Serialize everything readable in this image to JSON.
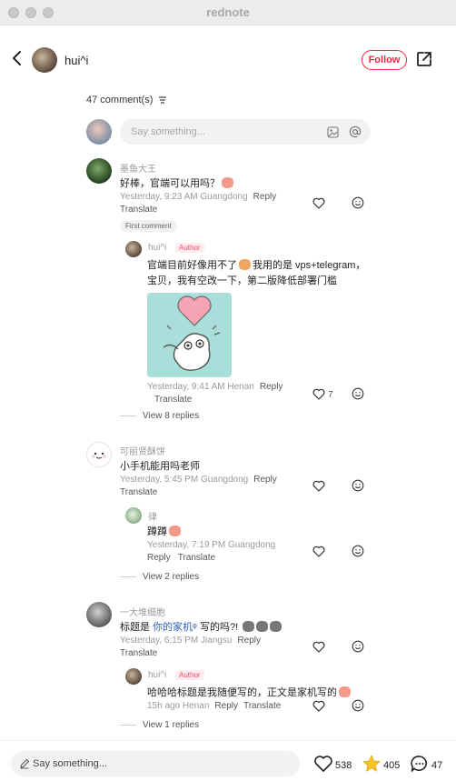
{
  "window": {
    "title": "rednote"
  },
  "header": {
    "username": "hui^i",
    "follow_label": "Follow"
  },
  "comments_meta": {
    "count_label": "47 comment(s)"
  },
  "comment_input": {
    "placeholder": "Say something..."
  },
  "comments": [
    {
      "name": "墨鱼大王",
      "text": "好棒，官端可以用吗？",
      "meta": "Yesterday, 9:23 AM Guangdong",
      "reply": "Reply",
      "translate": "Translate",
      "tag": "First comment",
      "replies": [
        {
          "name": "hui^i",
          "badge": "Author",
          "text_line1": "官端目前好像用不了",
          "text_line1b": "我用的是 vps+telegram，",
          "text_line2": "宝贝，我有空改一下，第二版降低部署门槛",
          "meta": "Yesterday, 9:41 AM Henan",
          "reply": "Reply",
          "translate": "Translate",
          "likes": "7"
        }
      ],
      "view_replies": "View 8 replies"
    },
    {
      "name": "可丽贤酥饼",
      "text": "小手机能用吗老师",
      "meta": "Yesterday, 5:45 PM Guangdong",
      "reply": "Reply",
      "translate": "Translate",
      "replies": [
        {
          "name": "律",
          "text": "蹲蹲",
          "meta": "Yesterday, 7:19 PM Guangdong",
          "reply": "Reply",
          "translate": "Translate"
        }
      ],
      "view_replies": "View 2 replies"
    },
    {
      "name": "一大堆细胞",
      "text_pre": "标题是 ",
      "text_link": "你的家机ᵠ",
      "text_post": " 写的吗?!",
      "meta": "Yesterday, 6:15 PM Jiangsu",
      "reply": "Reply",
      "translate": "Translate",
      "replies": [
        {
          "name": "hui^i",
          "badge": "Author",
          "text": "哈哈哈标题是我随便写的，正文是家机写的",
          "meta": "15h ago Henan",
          "reply": "Reply",
          "translate": "Translate"
        }
      ],
      "view_replies": "View 1 replies"
    }
  ],
  "bottom_bar": {
    "placeholder": "Say something...",
    "likes": "538",
    "stars": "405",
    "comments": "47"
  },
  "colors": {
    "brand_red": "#ff2442",
    "star_yellow": "#f6c32b"
  },
  "icons": [
    "back-arrow-icon",
    "share-icon",
    "sort-icon",
    "image-icon",
    "at-icon",
    "heart-icon",
    "smile-icon",
    "pencil-icon",
    "star-icon",
    "comment-icon"
  ]
}
